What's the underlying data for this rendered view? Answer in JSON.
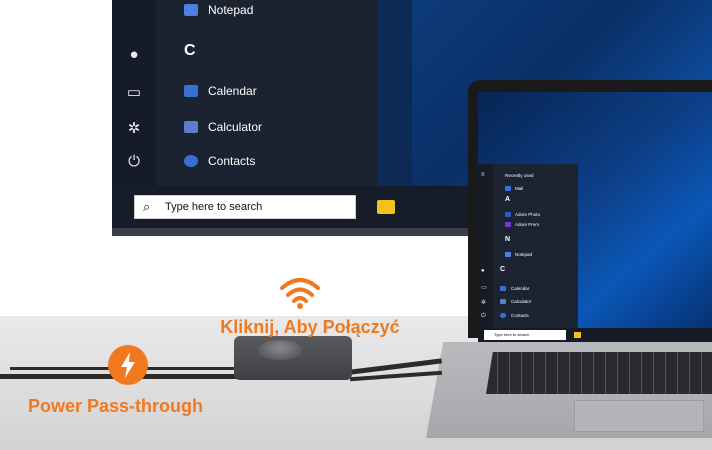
{
  "monitor": {
    "menu": {
      "top_item": "Notepad",
      "letter": "C",
      "items": [
        {
          "label": "Calendar",
          "icon": "calendar-icon",
          "color": "#3a6fd8"
        },
        {
          "label": "Calculator",
          "icon": "calculator-icon",
          "color": "#5b7fd0"
        },
        {
          "label": "Contacts",
          "icon": "contacts-icon",
          "color": "#3a6fd8"
        }
      ],
      "rail_icons": [
        "user-icon",
        "picture-icon",
        "gear-icon",
        "power-icon"
      ]
    },
    "search_placeholder": "Type here to search"
  },
  "laptop": {
    "menu": {
      "recent_header": "Recently used",
      "recent_item": "Mail",
      "sections": [
        {
          "letter": "A",
          "items": [
            "Adore Photo",
            "Adore Prem"
          ]
        },
        {
          "letter": "N",
          "items": [
            "Notepad"
          ]
        },
        {
          "letter": "C",
          "items": [
            "Calendar",
            "Calculator",
            "Contacts"
          ]
        }
      ]
    },
    "search_placeholder": "Type here to search"
  },
  "overlay": {
    "connect_label": "Kliknij, Aby Połączyć",
    "power_label": "Power Pass-through",
    "accent": "#f07920"
  }
}
